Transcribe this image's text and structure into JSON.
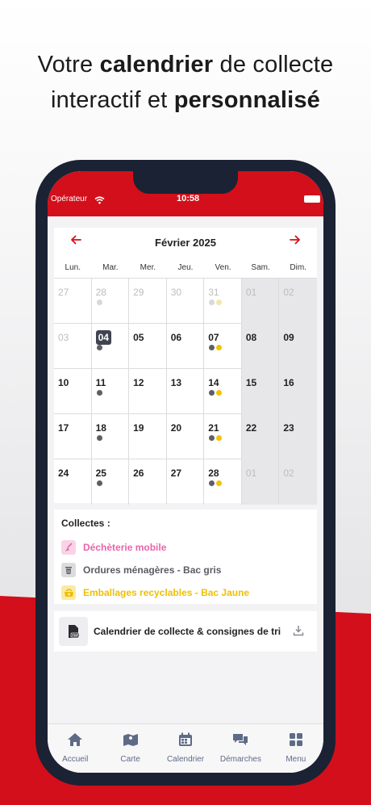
{
  "headline": {
    "line1_pre": "Votre ",
    "line1_bold": "calendrier",
    "line1_post": " de collecte",
    "line2_pre": "interactif et ",
    "line2_bold": "personnalisé"
  },
  "status_bar": {
    "carrier": "Opérateur",
    "time": "10:58"
  },
  "calendar": {
    "month": "Février 2025",
    "prev_icon": "arrow-left-icon",
    "next_icon": "arrow-right-icon",
    "weekdays": [
      "Lun.",
      "Mar.",
      "Mer.",
      "Jeu.",
      "Ven.",
      "Sam.",
      "Dim."
    ],
    "weeks": [
      [
        {
          "day": "27",
          "muted": true,
          "dots": []
        },
        {
          "day": "28",
          "muted": true,
          "dots": [
            "gray"
          ]
        },
        {
          "day": "29",
          "muted": true,
          "dots": []
        },
        {
          "day": "30",
          "muted": true,
          "dots": []
        },
        {
          "day": "31",
          "muted": true,
          "dots": [
            "gray",
            "yellow"
          ]
        },
        {
          "day": "01",
          "muted": true,
          "dots": []
        },
        {
          "day": "02",
          "muted": true,
          "dots": []
        }
      ],
      [
        {
          "day": "03",
          "muted": true,
          "dots": []
        },
        {
          "day": "04",
          "today": true,
          "dots": [
            "gray"
          ]
        },
        {
          "day": "05",
          "dots": []
        },
        {
          "day": "06",
          "dots": []
        },
        {
          "day": "07",
          "dots": [
            "gray",
            "yellow"
          ]
        },
        {
          "day": "08",
          "dots": []
        },
        {
          "day": "09",
          "dots": []
        }
      ],
      [
        {
          "day": "10",
          "dots": []
        },
        {
          "day": "11",
          "dots": [
            "gray"
          ]
        },
        {
          "day": "12",
          "dots": []
        },
        {
          "day": "13",
          "dots": []
        },
        {
          "day": "14",
          "dots": [
            "gray",
            "yellow"
          ]
        },
        {
          "day": "15",
          "dots": []
        },
        {
          "day": "16",
          "dots": []
        }
      ],
      [
        {
          "day": "17",
          "dots": []
        },
        {
          "day": "18",
          "dots": [
            "gray"
          ]
        },
        {
          "day": "19",
          "dots": []
        },
        {
          "day": "20",
          "dots": []
        },
        {
          "day": "21",
          "dots": [
            "gray",
            "yellow"
          ]
        },
        {
          "day": "22",
          "dots": []
        },
        {
          "day": "23",
          "dots": []
        }
      ],
      [
        {
          "day": "24",
          "dots": []
        },
        {
          "day": "25",
          "dots": [
            "gray"
          ]
        },
        {
          "day": "26",
          "dots": []
        },
        {
          "day": "27",
          "dots": []
        },
        {
          "day": "28",
          "dots": [
            "gray",
            "yellow"
          ]
        },
        {
          "day": "01",
          "muted": true,
          "dots": []
        },
        {
          "day": "02",
          "muted": true,
          "dots": []
        }
      ]
    ]
  },
  "legend": {
    "title": "Collectes :",
    "items": [
      {
        "label": "Déchèterie mobile",
        "color": "#e865a8",
        "bg": "#f8d4e6",
        "icon": "broom-icon"
      },
      {
        "label": "Ordures ménagères - Bac gris",
        "color": "#5b5b63",
        "bg": "#dcdcde",
        "icon": "trash-bin-icon"
      },
      {
        "label": "Emballages recyclables - Bac Jaune",
        "color": "#efbf00",
        "bg": "#fbeaa4",
        "icon": "recycle-box-icon"
      }
    ]
  },
  "download": {
    "label": "Calendrier de collecte & consignes de tri",
    "file_icon": "pdf-file-icon",
    "action_icon": "download-icon"
  },
  "tabbar": [
    {
      "label": "Accueil",
      "icon": "home-icon"
    },
    {
      "label": "Carte",
      "icon": "map-icon"
    },
    {
      "label": "Calendrier",
      "icon": "calendar-icon"
    },
    {
      "label": "Démarches",
      "icon": "chat-bubbles-icon"
    },
    {
      "label": "Menu",
      "icon": "grid-menu-icon"
    }
  ],
  "colors": {
    "brand_red": "#d20f1a",
    "dark_frame": "#1b2233",
    "tab_icon": "#5d6b86"
  }
}
